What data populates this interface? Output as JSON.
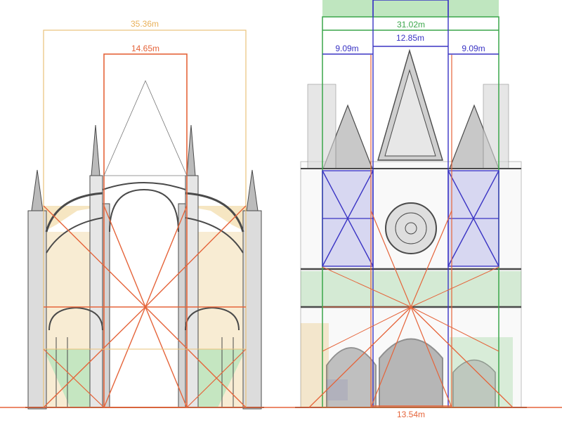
{
  "colors": {
    "orange": "#e5643a",
    "beige": "#e9c27a",
    "green": "#3aa64a",
    "blue": "#3a34c4",
    "stone": "#4a4a4a",
    "stone_light": "#9a9a9a",
    "fill_beige": "#f3ddae",
    "fill_green": "#bfe6bf",
    "fill_blue": "#b8b8ef"
  },
  "left_section": {
    "total_width_label": "35.36m",
    "nave_width_label": "14.65m"
  },
  "right_facade": {
    "total_width_label": "31.02m",
    "central_width_label": "12.85m",
    "left_bay_label": "9.09m",
    "right_bay_label": "9.09m",
    "portal_width_label": "13.54m"
  }
}
